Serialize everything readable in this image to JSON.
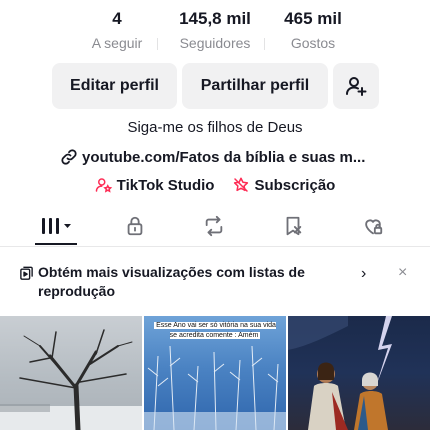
{
  "stats": {
    "following": {
      "value": "4",
      "label": "A seguir"
    },
    "followers": {
      "value": "145,8 mil",
      "label": "Seguidores"
    },
    "likes": {
      "value": "465 mil",
      "label": "Gostos"
    }
  },
  "actions": {
    "edit_label": "Editar perfil",
    "share_label": "Partilhar perfil",
    "add_friend_icon": "add-user-icon"
  },
  "profile": {
    "bio": "Siga-me os filhos de Deus",
    "link": "youtube.com/Fatos da bíblia e suas m...",
    "studio_label": "TikTok Studio",
    "subscription_label": "Subscrição"
  },
  "tabs": [
    {
      "icon": "grid-icon",
      "active": true
    },
    {
      "icon": "lock-icon",
      "active": false
    },
    {
      "icon": "repost-icon",
      "active": false
    },
    {
      "icon": "bookmark-icon",
      "active": false
    },
    {
      "icon": "liked-heart-icon",
      "active": false
    }
  ],
  "banner": {
    "text": "Obtém mais visualizações com listas de reprodução",
    "arrow": "›",
    "close": "×"
  },
  "videos": [
    {
      "caption": ""
    },
    {
      "caption": "Esse Ano vai ser só vitória na sua vida se acredita comente : Amém"
    },
    {
      "caption": ""
    }
  ],
  "colors": {
    "text": "#161823",
    "muted": "#8a8b91",
    "button_bg": "#f1f1f2",
    "accent_pink": "#fe2c55"
  }
}
